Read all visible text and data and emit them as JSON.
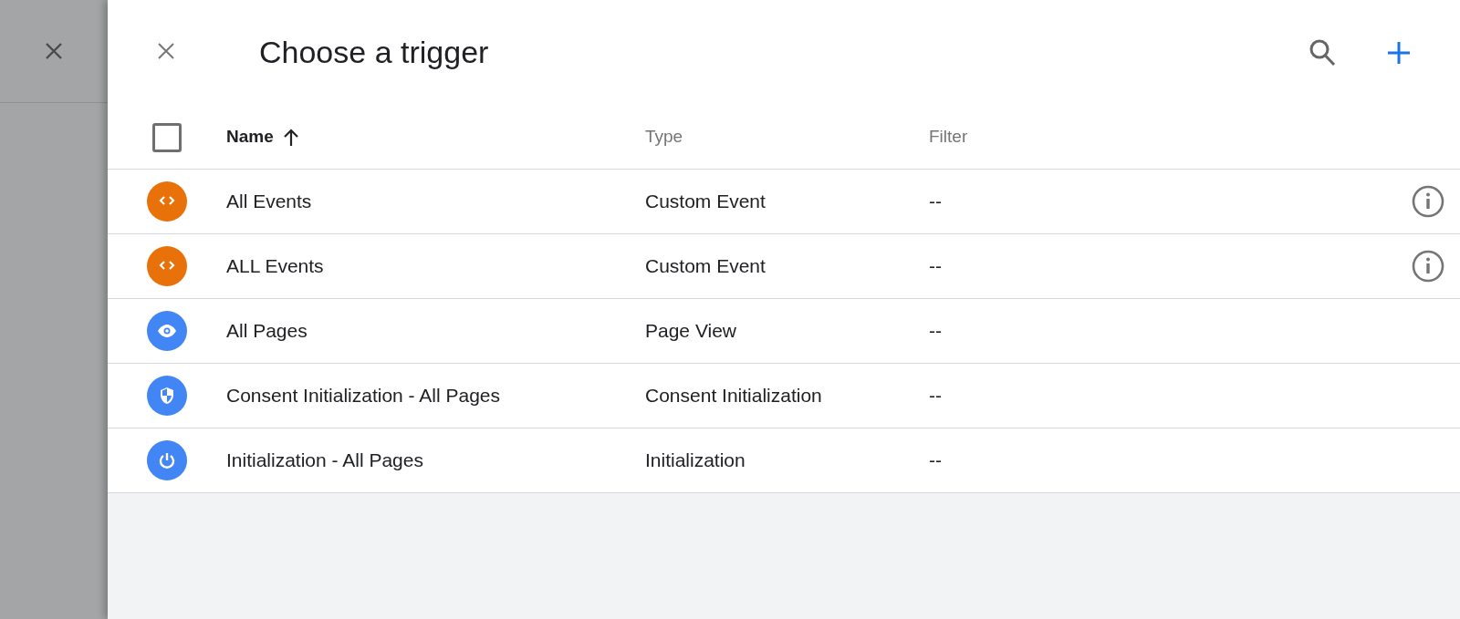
{
  "panel": {
    "title": "Choose a trigger"
  },
  "table": {
    "select_all": {
      "checked": false
    },
    "columns": [
      {
        "label": "Name",
        "sorted": true
      },
      {
        "label": "Type",
        "sorted": false
      },
      {
        "label": "Filter",
        "sorted": false
      }
    ],
    "rows": [
      {
        "kind": "custom",
        "name": "All Events",
        "type": "Custom Event",
        "filter": "--",
        "info": true
      },
      {
        "kind": "custom",
        "name": "ALL Events",
        "type": "Custom Event",
        "filter": "--",
        "info": true
      },
      {
        "kind": "pageview",
        "name": "All Pages",
        "type": "Page View",
        "filter": "--",
        "info": false
      },
      {
        "kind": "consent",
        "name": "Consent Initialization - All Pages",
        "type": "Consent Initialization",
        "filter": "--",
        "info": false
      },
      {
        "kind": "init",
        "name": "Initialization - All Pages",
        "type": "Initialization",
        "filter": "--",
        "info": false
      }
    ]
  }
}
